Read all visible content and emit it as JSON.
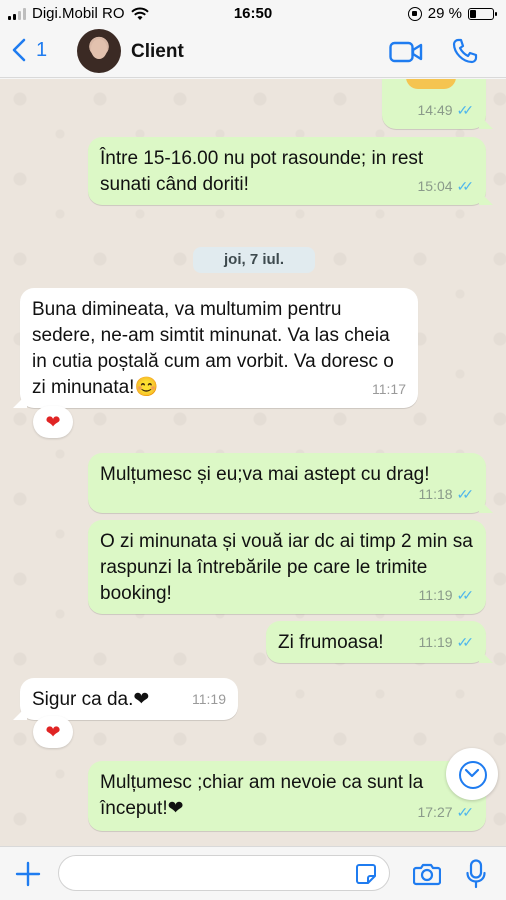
{
  "status_bar": {
    "carrier": "Digi.Mobil RO",
    "time": "16:50",
    "battery": "29 %"
  },
  "header": {
    "back_count": "1",
    "contact_name": "Client"
  },
  "messages": [
    {
      "id": "m1",
      "direction": "out",
      "text": "",
      "time": "14:49",
      "ticks": "✓✓"
    },
    {
      "id": "m2",
      "direction": "out",
      "text": "Între 15-16.00 nu pot rasounde; in rest sunati când doriti!",
      "time": "15:04",
      "ticks": "✓✓"
    },
    {
      "id": "m3",
      "direction": "in",
      "text": "Buna dimineata, va multumim pentru sedere, ne-am simtit minunat. Va las cheia in cutia poștală cum am vorbit. Va doresc o zi minunata!😊",
      "time": "11:17",
      "reaction": "❤"
    },
    {
      "id": "m4",
      "direction": "out",
      "text": "Mulțumesc și eu;va mai astept cu drag!",
      "time": "11:18",
      "ticks": "✓✓"
    },
    {
      "id": "m5",
      "direction": "out",
      "text": "O zi minunata și vouă iar dc ai timp 2 min sa raspunzi la întrebările pe care le trimite booking!",
      "time": "11:19",
      "ticks": "✓✓"
    },
    {
      "id": "m6",
      "direction": "out",
      "text": "Zi frumoasa!",
      "time": "11:19",
      "ticks": "✓✓"
    },
    {
      "id": "m7",
      "direction": "in",
      "text": "Sigur ca da.❤",
      "time": "11:19",
      "reaction": "❤"
    },
    {
      "id": "m8",
      "direction": "out",
      "text": "Mulțumesc ;chiar am nevoie ca sunt la început!❤",
      "time": "17:27",
      "ticks": "✓✓"
    }
  ],
  "date_separator": "joi, 7 iul.",
  "input": {
    "placeholder": "",
    "value": ""
  },
  "colors": {
    "accent": "#1f7cf0",
    "outgoing": "#dcf8c6",
    "incoming": "#ffffff",
    "chat_bg": "#ece5dd",
    "heart": "#e02424"
  }
}
